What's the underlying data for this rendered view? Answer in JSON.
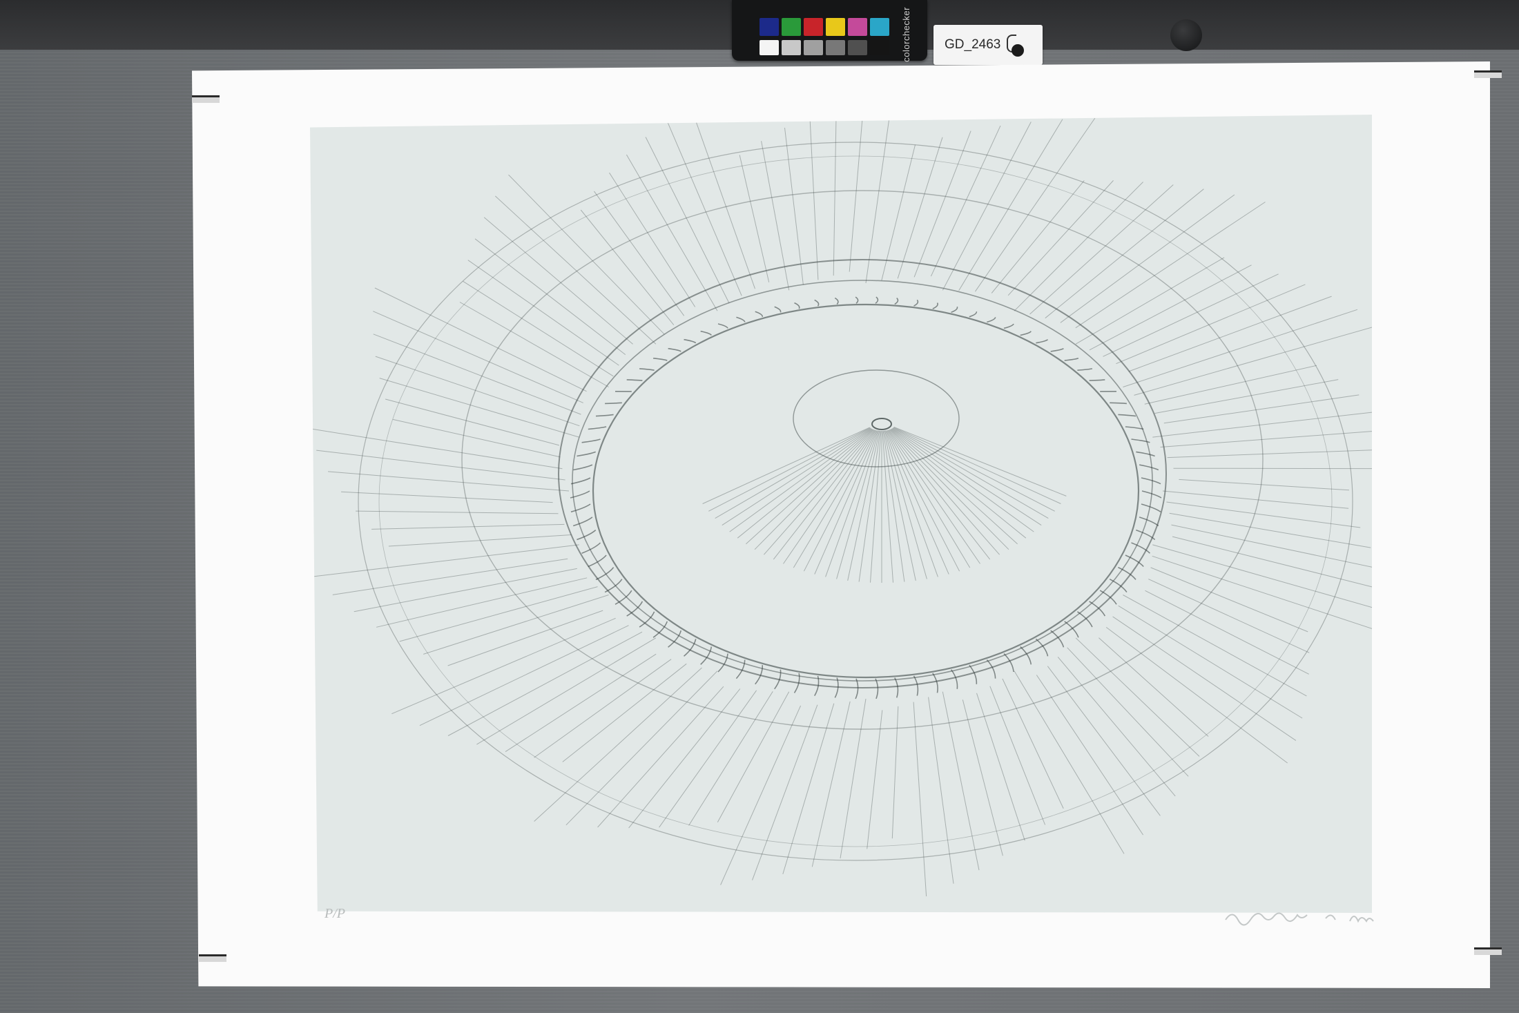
{
  "label_card": {
    "text": "GD_2463"
  },
  "color_checker": {
    "brand": "colorchecker",
    "top_row": [
      "#1c2a8a",
      "#2a9a3a",
      "#c8242a",
      "#e8c81a",
      "#c44a9a",
      "#2aa6c8"
    ],
    "bottom_row": [
      "#f4f4f4",
      "#c8c8c8",
      "#a0a0a0",
      "#787878",
      "#505050",
      "#151515"
    ]
  },
  "artwork": {
    "edition_note": "P/P",
    "signature": "signature and date (illegible pencil)",
    "ink_color": "#3c4646",
    "plate_tone": "#e2e8e7"
  }
}
